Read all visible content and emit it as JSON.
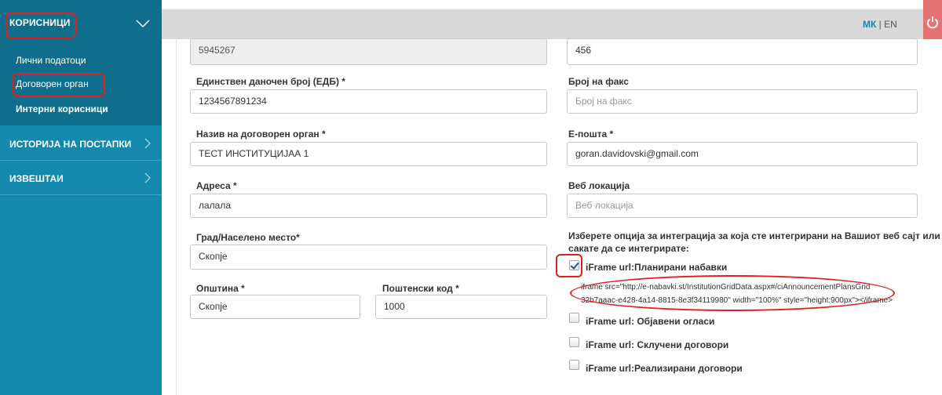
{
  "sidebar": {
    "header_label": "КОРИСНИЦИ",
    "sub_items": [
      "Лични податоци",
      "Договорен орган",
      "Интерни корисници"
    ],
    "sections": [
      "ИСТОРИЈА НА ПОСТАПКИ",
      "ИЗВЕШТАИ"
    ]
  },
  "topbar": {
    "lang_mk": "МК",
    "lang_sep": " | ",
    "lang_en": "EN",
    "power_icon": "power-icon"
  },
  "form": {
    "left": {
      "top_value": "5945267",
      "edb_label": "Единствен даночен број (ЕДБ) *",
      "edb_value": "1234567891234",
      "name_label": "Назив на договорен орган *",
      "name_value": "ТЕСТ ИНСТИТУЦИЈАА 1",
      "address_label": "Адреса *",
      "address_value": "лалала",
      "city_label": "Град/Населено место*",
      "city_value": "Скопје",
      "municipality_label": "Општина *",
      "municipality_value": "Скопје",
      "postal_label": "Поштенски код *",
      "postal_value": "1000"
    },
    "right": {
      "top_value": "456",
      "fax_label": "Број на факс",
      "fax_placeholder": "Број на факс",
      "email_label": "Е-пошта *",
      "email_value": "goran.davidovski@gmail.com",
      "web_label": "Веб локација",
      "web_placeholder": "Веб локација",
      "integration_text_line1": "Изберете опција за интеграција за која сте интегрирани на Вашиот веб сајт или",
      "integration_text_line2": "сакате да се интегрирате:",
      "options": [
        {
          "label": "iFrame url:Планирани набавки",
          "checked": true
        },
        {
          "label": "iFrame url: Објавени огласи",
          "checked": false
        },
        {
          "label": "iFrame url: Склучени договори",
          "checked": false
        },
        {
          "label": "iFrame url:Реализирани договори",
          "checked": false
        }
      ],
      "iframe_code_line1": "iframe src=\"http://e-nabavki.st/InstitutionGridData.aspx#/ciAnnouncementPlansGrid",
      "iframe_code_line2": "32b7aaac-e428-4a14-8815-8e3f34119980\" width=\"100%\" style=\"height:900px\"></iframe>"
    }
  },
  "colors": {
    "sidebar": "#1588ad",
    "sidebar_dark": "#0f6e8c",
    "annotation": "#e0201f",
    "power": "#e57373"
  }
}
